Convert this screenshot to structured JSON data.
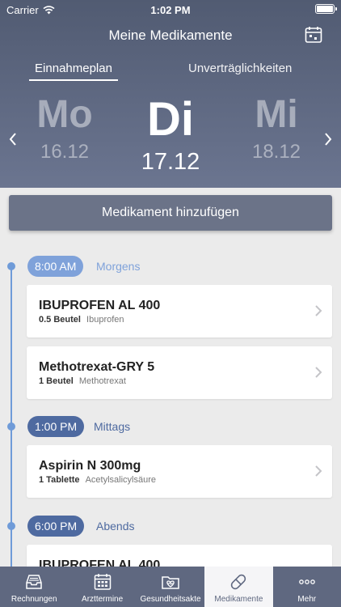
{
  "status_bar": {
    "carrier": "Carrier",
    "time": "1:02 PM"
  },
  "nav": {
    "title": "Meine Medikamente"
  },
  "tabs": {
    "active": "Einnahmeplan",
    "other": "Unverträglichkeiten"
  },
  "days": {
    "prev": {
      "abbr": "Mo",
      "date": "16.12"
    },
    "current": {
      "abbr": "Di",
      "date": "17.12"
    },
    "next": {
      "abbr": "Mi",
      "date": "18.12"
    }
  },
  "add_button": "Medikament hinzufügen",
  "schedule": [
    {
      "time": "8:00 AM",
      "label": "Morgens",
      "pill_color": "#7fa2da",
      "label_color": "#7fa2da",
      "meds": [
        {
          "name": "IBUPROFEN AL 400",
          "dose": "0.5 Beutel",
          "substance": "Ibuprofen"
        },
        {
          "name": "Methotrexat-GRY 5",
          "dose": "1 Beutel",
          "substance": "Methotrexat"
        }
      ]
    },
    {
      "time": "1:00 PM",
      "label": "Mittags",
      "pill_color": "#4e6aa0",
      "label_color": "#4e6aa0",
      "meds": [
        {
          "name": "Aspirin N 300mg",
          "dose": "1 Tablette",
          "substance": "Acetylsalicylsäure"
        }
      ]
    },
    {
      "time": "6:00 PM",
      "label": "Abends",
      "pill_color": "#4e6aa0",
      "label_color": "#4e6aa0",
      "meds": [
        {
          "name": "IBUPROFEN AL 400",
          "dose": "",
          "substance": ""
        }
      ]
    }
  ],
  "tabbar": [
    {
      "label": "Rechnungen",
      "icon": "inbox-tray-icon"
    },
    {
      "label": "Arzttermine",
      "icon": "calendar-grid-icon"
    },
    {
      "label": "Gesundheitsakte",
      "icon": "health-folder-icon"
    },
    {
      "label": "Medikamente",
      "icon": "pill-capsule-icon",
      "active": true
    },
    {
      "label": "Mehr",
      "icon": "more-dots-icon"
    }
  ]
}
